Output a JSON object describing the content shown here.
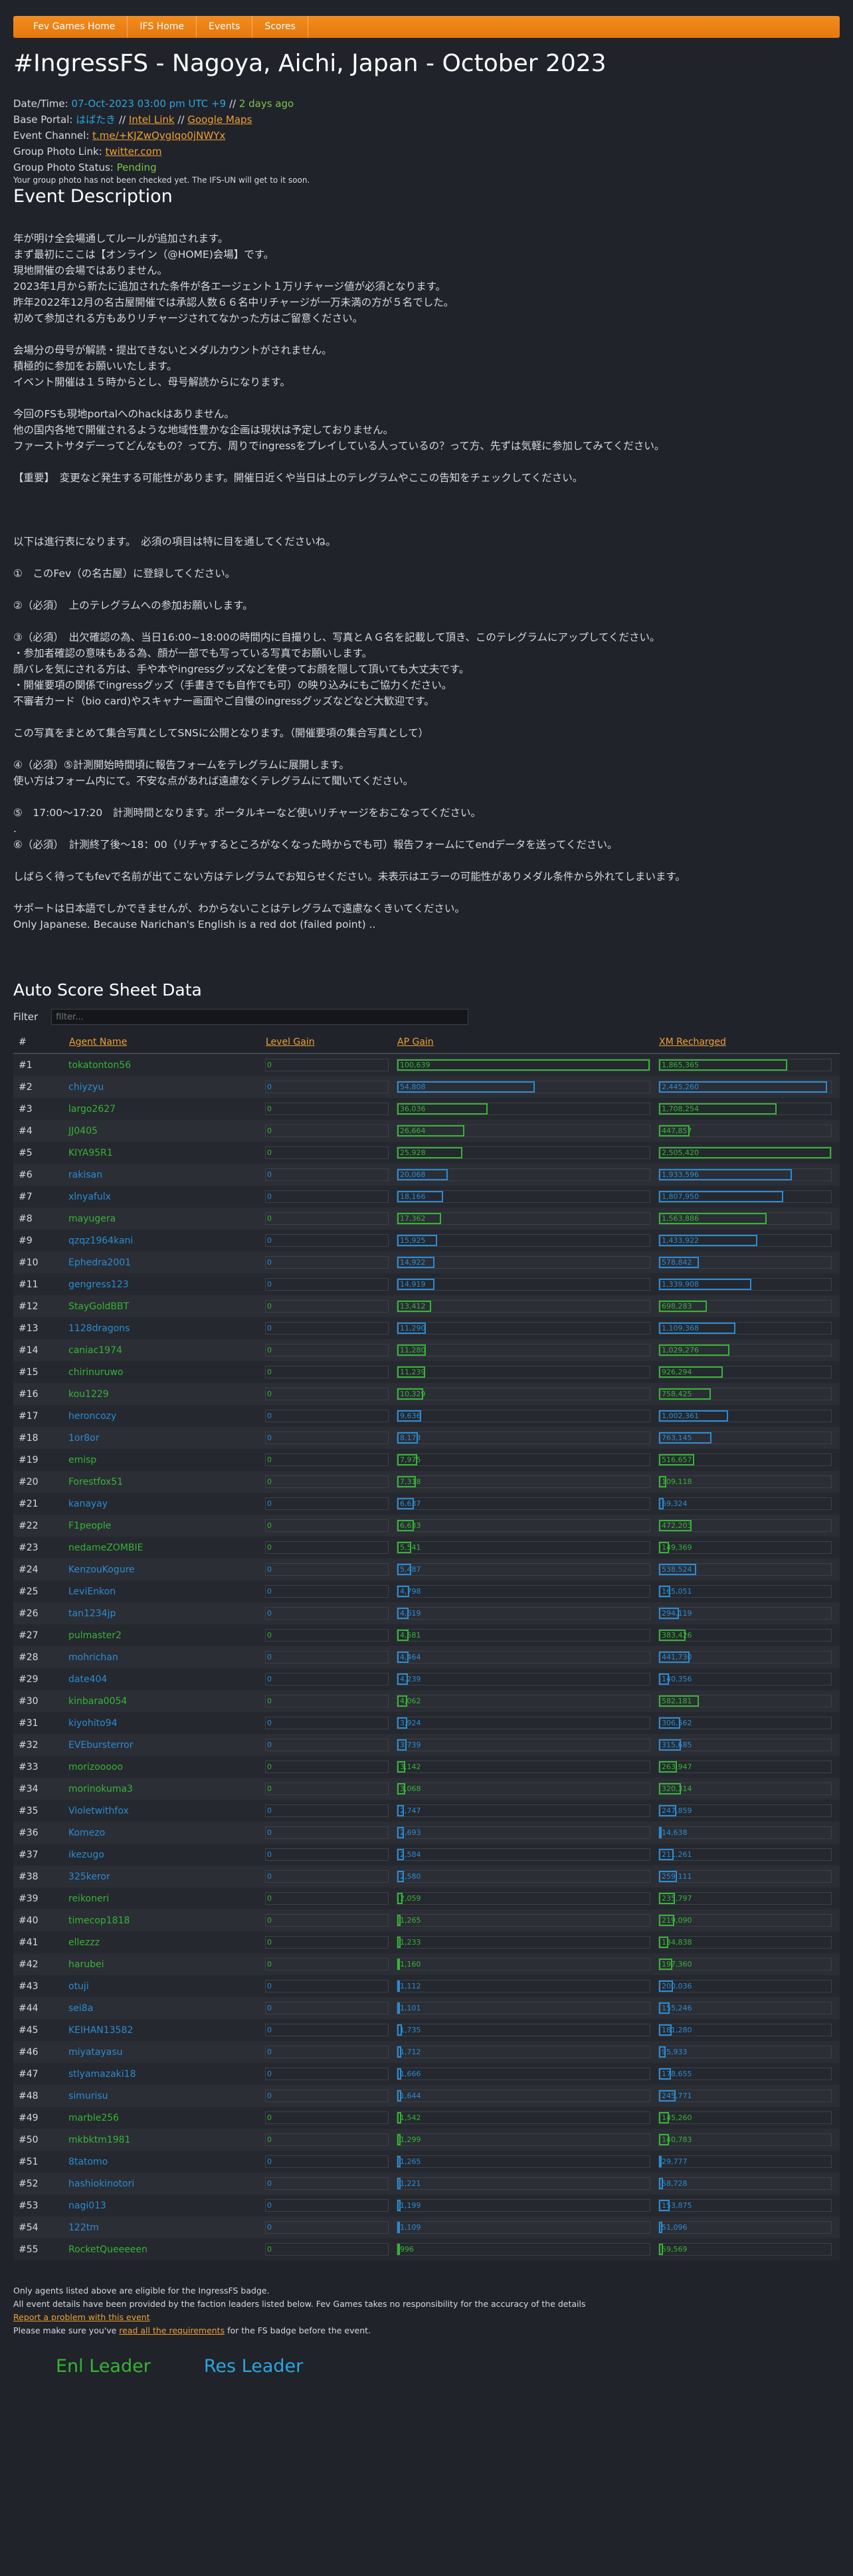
{
  "nav": [
    "Fev Games Home",
    "IFS Home",
    "Events",
    "Scores"
  ],
  "title": "#IngressFS - Nagoya, Aichi, Japan - October 2023",
  "info": {
    "datetime_label": "Date/Time: ",
    "datetime_value": "07-Oct-2023 03:00 pm UTC +9",
    "datetime_sep": " // ",
    "datetime_ago": "2 days ago",
    "portal_label": "Base Portal: ",
    "portal_name": "はばたき",
    "portal_sep1": " // ",
    "intel_link": "Intel Link",
    "portal_sep2": " // ",
    "maps_link": "Google Maps",
    "channel_label": "Event Channel: ",
    "channel_value": "t.me/+KJZwQvgIqo0jNWYx",
    "photo_label": "Group Photo Link: ",
    "photo_value": "twitter.com",
    "status_label": "Group Photo Status: ",
    "status_value": "Pending",
    "status_note": "Your group photo has not been checked yet. The IFS-UN will get to it soon."
  },
  "desc_title": "Event Description",
  "description": "年が明け全会場通してルールが追加されます。\nまず最初にここは【オンライン（@HOME)会場】です。\n現地開催の会場ではありません。\n2023年1月から新たに追加された条件が各エージェント１万リチャージ値が必須となります。\n昨年2022年12月の名古屋開催では承認人数６６名中リチャージが一万未満の方が５名でした。\n初めて参加される方もありリチャージされてなかった方はご留意ください。\n\n会場分の母号が解読・提出できないとメダルカウントがされません。\n積極的に参加をお願いいたします。\nイベント開催は１５時からとし、母号解読からになります。\n\n今回のFSも現地portalへのhackはありません。\n他の国内各地で開催されるような地域性豊かな企画は現状は予定しておりません。\nファーストサタデーってどんなもの？って方、周りでingressをプレイしている人っているの？って方、先ずは気軽に参加してみてください。\n\n【重要】　変更など発生する可能性があります。開催日近くや当日は上のテレグラムやここの告知をチェックしてください。\n\n\n\n以下は進行表になります。　必須の項目は特に目を通してくださいね。\n\n①　このFev（の名古屋）に登録してください。\n\n②（必須）　上のテレグラムへの参加お願いします。\n\n③（必須）　出欠確認の為、当日16:00~18:00の時間内に自撮りし、写真とＡＧ名を記載して頂き、このテレグラムにアップしてください。\n・参加者確認の意味もある為、顔が一部でも写っている写真でお願いします。\n顔バレを気にされる方は、手や本やingressグッズなどを使ってお顔を隠して頂いても大丈夫です。\n・開催要項の関係でingressグッズ（手書きでも自作でも可）の映り込みにもご協力ください。\n不審者カード（bio card)やスキャナー画面やご自慢のingressグッズなどなど大歓迎です。\n\nこの写真をまとめて集合写真としてSNSに公開となります。（開催要項の集合写真として）\n\n④（必須）⑤計測開始時間頃に報告フォームをテレグラムに展開します。\n使い方はフォーム内にて。不安な点があれば遠慮なくテレグラムにて聞いてください。\n\n⑤　17:00〜17:20　計測時間となります。ポータルキーなど使いリチャージをおこなってください。\n.\n⑥（必須）　計測終了後〜18：00（リチャするところがなくなった時からでも可）報告フォームにてendデータを送ってください。\n\nしばらく待ってもfevで名前が出てこない方はテレグラムでお知らせください。未表示はエラーの可能性がありメダル条件から外れてしまいます。\n\nサポートは日本語でしかできませんが、わからないことはテレグラムで遠慮なくきいてください。\nOnly Japanese. Because Narichan's English is a red dot (failed point) ..",
  "score_title": "Auto Score Sheet Data",
  "filter_label": "Filter",
  "filter_placeholder": "filter...",
  "table_headers": [
    "#",
    "Agent Name",
    "Level Gain",
    "AP Gain",
    "XM Recharged"
  ],
  "colors": {
    "enl": "#36b436",
    "res": "#2a8cd4",
    "link": "#f0a030"
  },
  "agents": [
    {
      "rank": "#1",
      "name": "tokatonton56",
      "faction": "enl",
      "level": "0",
      "ap": "100,639",
      "ap_n": 100639,
      "xm": "1,865,365",
      "xm_n": 1865365
    },
    {
      "rank": "#2",
      "name": "chiyzyu",
      "faction": "res",
      "level": "0",
      "ap": "54,808",
      "ap_n": 54808,
      "xm": "2,445,260",
      "xm_n": 2445260
    },
    {
      "rank": "#3",
      "name": "largo2627",
      "faction": "enl",
      "level": "0",
      "ap": "36,036",
      "ap_n": 36036,
      "xm": "1,708,254",
      "xm_n": 1708254
    },
    {
      "rank": "#4",
      "name": "JJ0405",
      "faction": "enl",
      "level": "0",
      "ap": "26,664",
      "ap_n": 26664,
      "xm": "447,857",
      "xm_n": 447857
    },
    {
      "rank": "#5",
      "name": "KIYA95R1",
      "faction": "enl",
      "level": "0",
      "ap": "25,928",
      "ap_n": 25928,
      "xm": "2,505,420",
      "xm_n": 2505420
    },
    {
      "rank": "#6",
      "name": "rakisan",
      "faction": "res",
      "level": "0",
      "ap": "20,068",
      "ap_n": 20068,
      "xm": "1,933,596",
      "xm_n": 1933596
    },
    {
      "rank": "#7",
      "name": "xlnyafulx",
      "faction": "res",
      "level": "0",
      "ap": "18,166",
      "ap_n": 18166,
      "xm": "1,807,950",
      "xm_n": 1807950
    },
    {
      "rank": "#8",
      "name": "mayugera",
      "faction": "enl",
      "level": "0",
      "ap": "17,362",
      "ap_n": 17362,
      "xm": "1,563,886",
      "xm_n": 1563886
    },
    {
      "rank": "#9",
      "name": "qzqz1964kani",
      "faction": "res",
      "level": "0",
      "ap": "15,925",
      "ap_n": 15925,
      "xm": "1,433,922",
      "xm_n": 1433922
    },
    {
      "rank": "#10",
      "name": "Ephedra2001",
      "faction": "res",
      "level": "0",
      "ap": "14,922",
      "ap_n": 14922,
      "xm": "578,842",
      "xm_n": 578842
    },
    {
      "rank": "#11",
      "name": "gengress123",
      "faction": "res",
      "level": "0",
      "ap": "14,919",
      "ap_n": 14919,
      "xm": "1,339,908",
      "xm_n": 1339908
    },
    {
      "rank": "#12",
      "name": "StayGoldBBT",
      "faction": "enl",
      "level": "0",
      "ap": "13,412",
      "ap_n": 13412,
      "xm": "698,283",
      "xm_n": 698283
    },
    {
      "rank": "#13",
      "name": "1128dragons",
      "faction": "res",
      "level": "0",
      "ap": "11,290",
      "ap_n": 11290,
      "xm": "1,109,368",
      "xm_n": 1109368
    },
    {
      "rank": "#14",
      "name": "caniac1974",
      "faction": "enl",
      "level": "0",
      "ap": "11,280",
      "ap_n": 11280,
      "xm": "1,029,276",
      "xm_n": 1029276
    },
    {
      "rank": "#15",
      "name": "chirinuruwo",
      "faction": "enl",
      "level": "0",
      "ap": "11,239",
      "ap_n": 11239,
      "xm": "926,294",
      "xm_n": 926294
    },
    {
      "rank": "#16",
      "name": "kou1229",
      "faction": "enl",
      "level": "0",
      "ap": "10,329",
      "ap_n": 10329,
      "xm": "758,425",
      "xm_n": 758425
    },
    {
      "rank": "#17",
      "name": "heroncozy",
      "faction": "res",
      "level": "0",
      "ap": "9,636",
      "ap_n": 9636,
      "xm": "1,002,361",
      "xm_n": 1002361
    },
    {
      "rank": "#18",
      "name": "1or8or",
      "faction": "res",
      "level": "0",
      "ap": "8,173",
      "ap_n": 8173,
      "xm": "763,145",
      "xm_n": 763145
    },
    {
      "rank": "#19",
      "name": "emisp",
      "faction": "enl",
      "level": "0",
      "ap": "7,975",
      "ap_n": 7975,
      "xm": "516,657",
      "xm_n": 516657
    },
    {
      "rank": "#20",
      "name": "Forestfox51",
      "faction": "enl",
      "level": "0",
      "ap": "7,318",
      "ap_n": 7318,
      "xm": "109,118",
      "xm_n": 109118
    },
    {
      "rank": "#21",
      "name": "kanayay",
      "faction": "res",
      "level": "0",
      "ap": "6,637",
      "ap_n": 6637,
      "xm": "69,324",
      "xm_n": 69324
    },
    {
      "rank": "#22",
      "name": "F1people",
      "faction": "enl",
      "level": "0",
      "ap": "6,633",
      "ap_n": 6633,
      "xm": "472,203",
      "xm_n": 472203
    },
    {
      "rank": "#23",
      "name": "nedameZOMBIE",
      "faction": "enl",
      "level": "0",
      "ap": "5,541",
      "ap_n": 5541,
      "xm": "149,369",
      "xm_n": 149369
    },
    {
      "rank": "#24",
      "name": "KenzouKogure",
      "faction": "res",
      "level": "0",
      "ap": "5,487",
      "ap_n": 5487,
      "xm": "538,524",
      "xm_n": 538524
    },
    {
      "rank": "#25",
      "name": "LeviEnkon",
      "faction": "res",
      "level": "0",
      "ap": "4,798",
      "ap_n": 4798,
      "xm": "165,051",
      "xm_n": 165051
    },
    {
      "rank": "#26",
      "name": "tan1234jp",
      "faction": "res",
      "level": "0",
      "ap": "4,619",
      "ap_n": 4619,
      "xm": "294,119",
      "xm_n": 294119
    },
    {
      "rank": "#27",
      "name": "pulmaster2",
      "faction": "enl",
      "level": "0",
      "ap": "4,581",
      "ap_n": 4581,
      "xm": "383,426",
      "xm_n": 383426
    },
    {
      "rank": "#28",
      "name": "mohrichan",
      "faction": "res",
      "level": "0",
      "ap": "4,464",
      "ap_n": 4464,
      "xm": "441,730",
      "xm_n": 441730
    },
    {
      "rank": "#29",
      "name": "date404",
      "faction": "res",
      "level": "0",
      "ap": "4,239",
      "ap_n": 4239,
      "xm": "140,356",
      "xm_n": 140356
    },
    {
      "rank": "#30",
      "name": "kinbara0054",
      "faction": "enl",
      "level": "0",
      "ap": "4,062",
      "ap_n": 4062,
      "xm": "582,181",
      "xm_n": 582181
    },
    {
      "rank": "#31",
      "name": "kiyohito94",
      "faction": "res",
      "level": "0",
      "ap": "3,924",
      "ap_n": 3924,
      "xm": "306,562",
      "xm_n": 306562
    },
    {
      "rank": "#32",
      "name": "EVEbursterror",
      "faction": "res",
      "level": "0",
      "ap": "3,739",
      "ap_n": 3739,
      "xm": "315,685",
      "xm_n": 315685
    },
    {
      "rank": "#33",
      "name": "morizooooo",
      "faction": "enl",
      "level": "0",
      "ap": "3,142",
      "ap_n": 3142,
      "xm": "263,947",
      "xm_n": 263947
    },
    {
      "rank": "#34",
      "name": "morinokuma3",
      "faction": "enl",
      "level": "0",
      "ap": "3,068",
      "ap_n": 3068,
      "xm": "320,314",
      "xm_n": 320314
    },
    {
      "rank": "#35",
      "name": "Violetwithfox",
      "faction": "res",
      "level": "0",
      "ap": "2,747",
      "ap_n": 2747,
      "xm": "247,859",
      "xm_n": 247859
    },
    {
      "rank": "#36",
      "name": "Komezo",
      "faction": "res",
      "level": "0",
      "ap": "2,693",
      "ap_n": 2693,
      "xm": "14,638",
      "xm_n": 14638
    },
    {
      "rank": "#37",
      "name": "ikezugo",
      "faction": "res",
      "level": "0",
      "ap": "2,584",
      "ap_n": 2584,
      "xm": "211,261",
      "xm_n": 211261
    },
    {
      "rank": "#38",
      "name": "325keror",
      "faction": "res",
      "level": "0",
      "ap": "2,580",
      "ap_n": 2580,
      "xm": "259,111",
      "xm_n": 259111
    },
    {
      "rank": "#39",
      "name": "reikoneri",
      "faction": "enl",
      "level": "0",
      "ap": "2,059",
      "ap_n": 2059,
      "xm": "235,797",
      "xm_n": 235797
    },
    {
      "rank": "#40",
      "name": "timecop1818",
      "faction": "enl",
      "level": "0",
      "ap": "1,265",
      "ap_n": 1265,
      "xm": "219,090",
      "xm_n": 219090
    },
    {
      "rank": "#41",
      "name": "ellezzz",
      "faction": "enl",
      "level": "0",
      "ap": "1,233",
      "ap_n": 1233,
      "xm": "134,838",
      "xm_n": 134838
    },
    {
      "rank": "#42",
      "name": "harubei",
      "faction": "enl",
      "level": "0",
      "ap": "1,160",
      "ap_n": 1160,
      "xm": "197,360",
      "xm_n": 197360
    },
    {
      "rank": "#43",
      "name": "otuji",
      "faction": "res",
      "level": "0",
      "ap": "1,112",
      "ap_n": 1112,
      "xm": "200,036",
      "xm_n": 200036
    },
    {
      "rank": "#44",
      "name": "sei8a",
      "faction": "res",
      "level": "0",
      "ap": "1,101",
      "ap_n": 1101,
      "xm": "155,246",
      "xm_n": 155246
    },
    {
      "rank": "#45",
      "name": "KEIHAN13582",
      "faction": "res",
      "level": "0",
      "ap": "1,735",
      "ap_n": 1735,
      "xm": "181,280",
      "xm_n": 181280
    },
    {
      "rank": "#46",
      "name": "miyatayasu",
      "faction": "res",
      "level": "0",
      "ap": "1,712",
      "ap_n": 1712,
      "xm": "95,933",
      "xm_n": 95933
    },
    {
      "rank": "#47",
      "name": "stlyamazaki18",
      "faction": "res",
      "level": "0",
      "ap": "1,666",
      "ap_n": 1666,
      "xm": "178,655",
      "xm_n": 178655
    },
    {
      "rank": "#48",
      "name": "simurisu",
      "faction": "res",
      "level": "0",
      "ap": "1,644",
      "ap_n": 1644,
      "xm": "245,771",
      "xm_n": 245771
    },
    {
      "rank": "#49",
      "name": "marble256",
      "faction": "enl",
      "level": "0",
      "ap": "1,542",
      "ap_n": 1542,
      "xm": "145,260",
      "xm_n": 145260
    },
    {
      "rank": "#50",
      "name": "mkbktm1981",
      "faction": "enl",
      "level": "0",
      "ap": "1,299",
      "ap_n": 1299,
      "xm": "140,783",
      "xm_n": 140783
    },
    {
      "rank": "#51",
      "name": "8tatomo",
      "faction": "res",
      "level": "0",
      "ap": "1,265",
      "ap_n": 1265,
      "xm": "29,777",
      "xm_n": 29777
    },
    {
      "rank": "#52",
      "name": "hashiokinotori",
      "faction": "res",
      "level": "0",
      "ap": "1,221",
      "ap_n": 1221,
      "xm": "58,728",
      "xm_n": 58728
    },
    {
      "rank": "#53",
      "name": "nagi013",
      "faction": "res",
      "level": "0",
      "ap": "1,199",
      "ap_n": 1199,
      "xm": "153,875",
      "xm_n": 153875
    },
    {
      "rank": "#54",
      "name": "122tm",
      "faction": "res",
      "level": "0",
      "ap": "1,109",
      "ap_n": 1109,
      "xm": "51,096",
      "xm_n": 51096
    },
    {
      "rank": "#55",
      "name": "RocketQueeeeen",
      "faction": "enl",
      "level": "0",
      "ap": "996",
      "ap_n": 996,
      "xm": "59,569",
      "xm_n": 59569
    }
  ],
  "footer": {
    "line1": "Only agents listed above are eligible for the IngressFS badge.",
    "line2": "All event details have been provided by the faction leaders listed below. Fev Games takes no responsibility for the accuracy of the details",
    "report_link": "Report a problem with this event",
    "line4_pre": "Please make sure you've ",
    "line4_link": "read all the requirements",
    "line4_post": " for the FS badge before the event."
  },
  "leaders": {
    "enl": "Enl Leader",
    "res": "Res Leader"
  }
}
